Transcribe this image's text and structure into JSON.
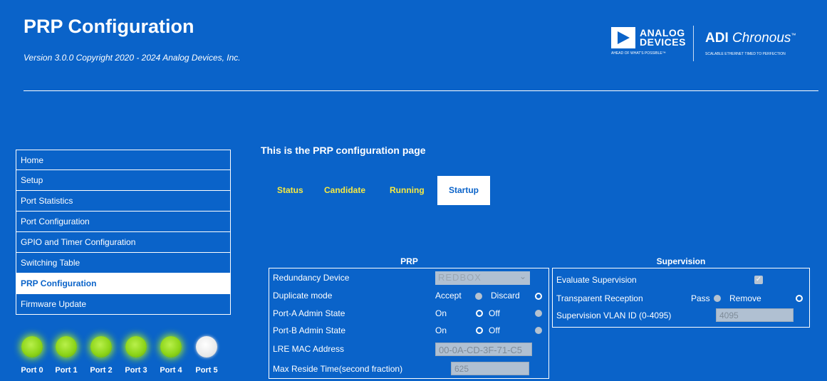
{
  "header": {
    "title": "PRP Configuration",
    "version": "Version 3.0.0 Copyright 2020 - 2024 Analog Devices, Inc.",
    "adi_logo": {
      "line1": "ANALOG",
      "line2": "DEVICES",
      "tagline": "AHEAD OF WHAT'S POSSIBLE™"
    },
    "chronous_logo": {
      "prefix": "ADI",
      "name": "Chronous",
      "tm": "™",
      "tagline": "SCALABLE ETHERNET TIMED TO PERFECTION"
    }
  },
  "sidebar": {
    "items": [
      {
        "label": "Home"
      },
      {
        "label": "Setup"
      },
      {
        "label": "Port Statistics"
      },
      {
        "label": "Port Configuration"
      },
      {
        "label": "GPIO and Timer Configuration"
      },
      {
        "label": "Switching Table"
      },
      {
        "label": "PRP Configuration",
        "active": true
      },
      {
        "label": "Firmware Update"
      }
    ]
  },
  "ports": [
    {
      "label": "Port 0",
      "status": "on"
    },
    {
      "label": "Port 1",
      "status": "on"
    },
    {
      "label": "Port 2",
      "status": "on"
    },
    {
      "label": "Port 3",
      "status": "on"
    },
    {
      "label": "Port 4",
      "status": "on"
    },
    {
      "label": "Port 5",
      "status": "off"
    }
  ],
  "main": {
    "heading": "This is the PRP configuration page",
    "tabs": [
      {
        "label": "Status"
      },
      {
        "label": "Candidate"
      },
      {
        "label": "Running"
      },
      {
        "label": "Startup",
        "active": true
      }
    ],
    "prp": {
      "title": "PRP",
      "redundancy_device": {
        "label": "Redundancy Device",
        "value": "REDBOX"
      },
      "duplicate_mode": {
        "label": "Duplicate mode",
        "option1": "Accept",
        "option2": "Discard",
        "selected": "Discard"
      },
      "port_a_admin_state": {
        "label": "Port-A Admin State",
        "option1": "On",
        "option2": "Off",
        "selected": "On"
      },
      "port_b_admin_state": {
        "label": "Port-B Admin State",
        "option1": "On",
        "option2": "Off",
        "selected": "On"
      },
      "lre_mac_address": {
        "label": "LRE MAC Address",
        "value": "00-0A-CD-3F-71-C5"
      },
      "max_reside_time": {
        "label": "Max Reside Time(second fraction)",
        "value": "625"
      }
    },
    "supervision": {
      "title": "Supervision",
      "evaluate": {
        "label": "Evaluate Supervision",
        "checked": true
      },
      "transparent_reception": {
        "label": "Transparent Reception",
        "option1": "Pass",
        "option2": "Remove",
        "selected": "Remove"
      },
      "vlan_id": {
        "label": "Supervision VLAN ID (0-4095)",
        "value": "4095"
      }
    }
  },
  "colors": {
    "background": "#0a63c9",
    "tab_text": "#f5e943",
    "port_on": "#8ed61a",
    "port_off": "#eaeaea"
  }
}
